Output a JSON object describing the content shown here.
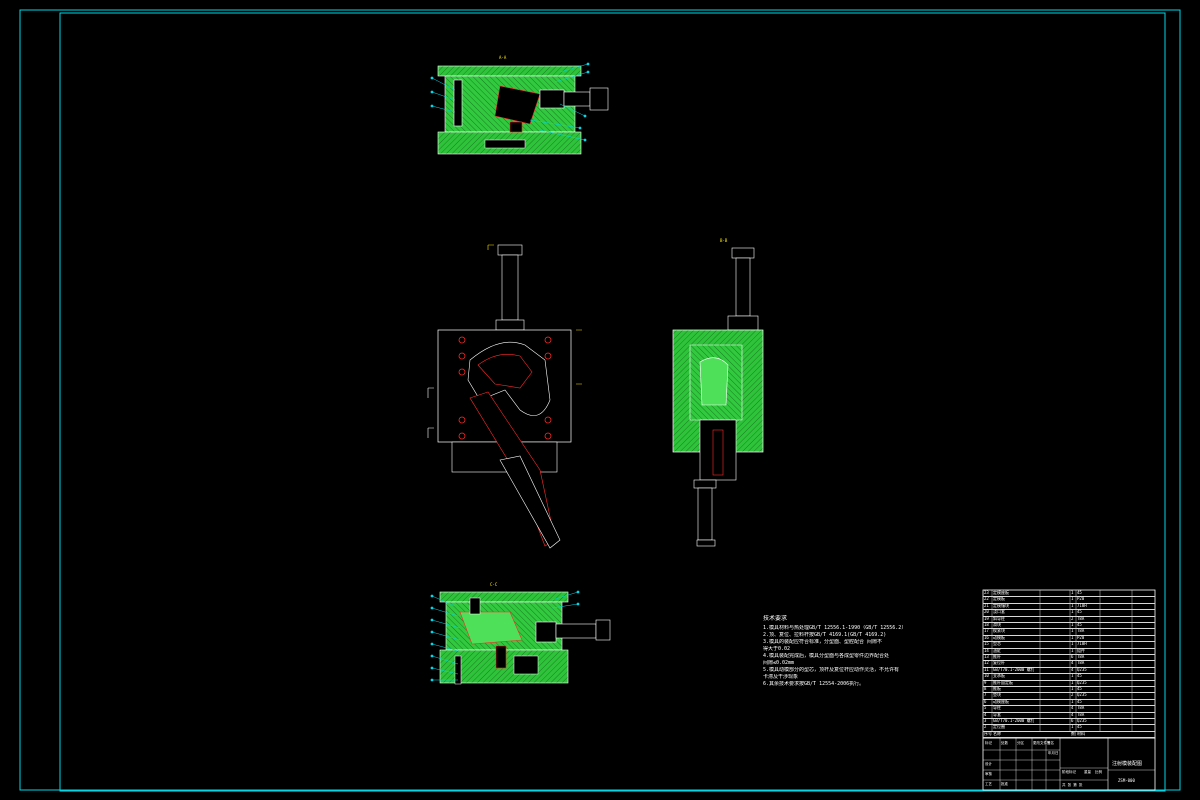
{
  "drawing": {
    "view_labels": {
      "top_section": "A-A",
      "side_view": "B-B",
      "bottom_section": "C-C"
    },
    "technical_notes": {
      "title": "技术要求",
      "items": [
        "1.模具材料与热处理GB/T 12556.1-1990（GB/T 12556.2）",
        "2.顶、复位、拉料杆按GB/T 4169.1(GB/T 4169.2)",
        "3.模具的装配应符合标准，分型面、型腔配合 间隙不",
        "   得大于0.02",
        "4.模具装配完成后，模具分型面与各成型零件边界配合处",
        "   间隙≤0.02mm",
        "5.模具动模部分的型芯，顶杆及复位杆应动作灵活，不允许有",
        "   卡滞及干涉现象",
        "6.其余技术要求按GB/T 12554-2006执行。"
      ]
    },
    "bom": {
      "rows": [
        {
          "no": "23",
          "name": "定模座板",
          "qty": "1",
          "material": "45"
        },
        {
          "no": "22",
          "name": "定模板",
          "qty": "1",
          "material": "P20"
        },
        {
          "no": "21",
          "name": "定模镶块",
          "qty": "1",
          "material": "718H"
        },
        {
          "no": "20",
          "name": "浇口套",
          "qty": "1",
          "material": "45"
        },
        {
          "no": "19",
          "name": "斜导柱",
          "qty": "2",
          "material": "T8A"
        },
        {
          "no": "18",
          "name": "滑块",
          "qty": "1",
          "material": "45"
        },
        {
          "no": "17",
          "name": "楔紧块",
          "qty": "1",
          "material": "T8A"
        },
        {
          "no": "16",
          "name": "动模板",
          "qty": "1",
          "material": "P20"
        },
        {
          "no": "15",
          "name": "型芯",
          "qty": "1",
          "material": "718H"
        },
        {
          "no": "14",
          "name": "油缸",
          "qty": "1",
          "material": "组件"
        },
        {
          "no": "13",
          "name": "推杆",
          "qty": "6",
          "material": "T8A"
        },
        {
          "no": "12",
          "name": "复位杆",
          "qty": "4",
          "material": "T8A"
        },
        {
          "no": "11",
          "name": "GB/T70.1-2000 螺钉",
          "qty": "4",
          "material": "Q235"
        },
        {
          "no": "10",
          "name": "支承板",
          "qty": "1",
          "material": "45"
        },
        {
          "no": "9",
          "name": "推杆固定板",
          "qty": "1",
          "material": "Q235"
        },
        {
          "no": "8",
          "name": "推板",
          "qty": "1",
          "material": "45"
        },
        {
          "no": "7",
          "name": "垫块",
          "qty": "2",
          "material": "Q235"
        },
        {
          "no": "6",
          "name": "动模座板",
          "qty": "1",
          "material": "45"
        },
        {
          "no": "5",
          "name": "导柱",
          "qty": "4",
          "material": "T8A"
        },
        {
          "no": "4",
          "name": "导套",
          "qty": "4",
          "material": "T8A"
        },
        {
          "no": "3",
          "name": "GB/T70.1-2000 螺钉",
          "qty": "6",
          "material": "Q235"
        },
        {
          "no": "2",
          "name": "定位圈",
          "qty": "1",
          "material": "45"
        }
      ],
      "header": {
        "no": "序号",
        "name": "名称",
        "qty": "数量",
        "material": "材料"
      }
    },
    "title_block": {
      "drawing_title": "注射模装配图",
      "drawing_number": "ZSM-000",
      "labels": [
        "标记",
        "处数",
        "分区",
        "更改文件号",
        "签名",
        "年月日",
        "设计",
        "审核",
        "工艺",
        "批准",
        "阶段标记",
        "重量",
        "比例",
        "共 张 第 张"
      ]
    },
    "colors": {
      "background": "#000000",
      "frame": "#00d8e8",
      "outline": "#ffffff",
      "hatch": "#2ec43a",
      "accent": "#ff2a2a",
      "label": "#ffea00",
      "leader": "#00d8e8"
    }
  }
}
